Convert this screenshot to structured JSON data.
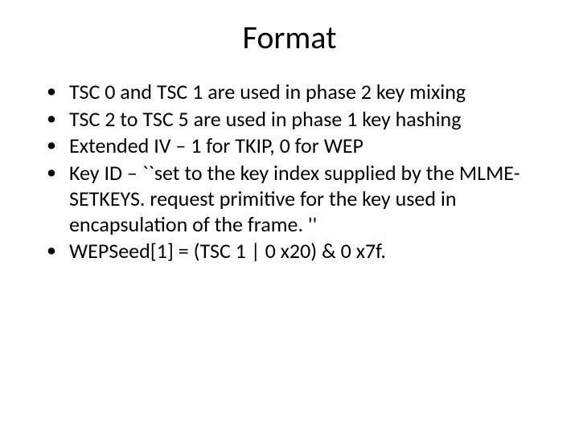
{
  "slide": {
    "title": "Format",
    "bullets": [
      "TSC 0 and TSC 1 are used in phase 2 key mixing",
      "TSC 2 to TSC 5 are used in phase 1 key hashing",
      "Extended IV – 1 for TKIP, 0 for WEP",
      "Key ID – ``set to the key index supplied by the MLME-SETKEYS. request primitive for the key used in encapsulation of the frame. ''",
      "WEPSeed[1] = (TSC 1 | 0 x20) & 0 x7f."
    ]
  }
}
